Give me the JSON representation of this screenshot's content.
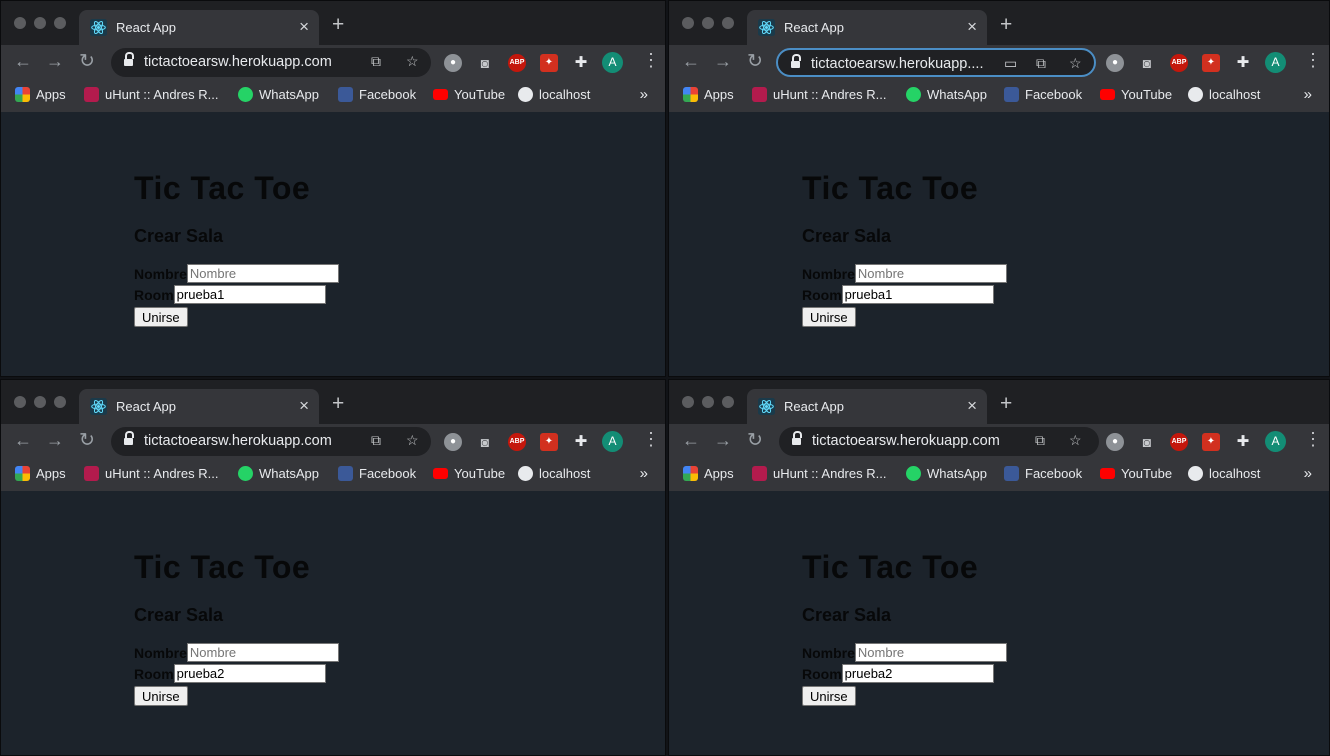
{
  "windows": [
    {
      "tab": {
        "title": "React App"
      },
      "address": {
        "url": "tictactoearsw.herokuapp.com",
        "focused": false
      },
      "bookmarks": [
        "Apps",
        "uHunt :: Andres R...",
        "WhatsApp",
        "Facebook",
        "YouTube",
        "localhost"
      ],
      "avatar": "A",
      "page": {
        "title": "Tic Tac Toe",
        "subtitle": "Crear Sala",
        "name_label": "Nombre",
        "name_placeholder": "Nombre",
        "name_value": "",
        "room_label": "Room",
        "room_value": "prueba1",
        "join_label": "Unirse"
      }
    },
    {
      "tab": {
        "title": "React App"
      },
      "address": {
        "url": "tictactoearsw.herokuapp....",
        "focused": true
      },
      "bookmarks": [
        "Apps",
        "uHunt :: Andres R...",
        "WhatsApp",
        "Facebook",
        "YouTube",
        "localhost"
      ],
      "avatar": "A",
      "page": {
        "title": "Tic Tac Toe",
        "subtitle": "Crear Sala",
        "name_label": "Nombre",
        "name_placeholder": "Nombre",
        "name_value": "",
        "room_label": "Room",
        "room_value": "prueba1",
        "join_label": "Unirse"
      }
    },
    {
      "tab": {
        "title": "React App"
      },
      "address": {
        "url": "tictactoearsw.herokuapp.com",
        "focused": false
      },
      "bookmarks": [
        "Apps",
        "uHunt :: Andres R...",
        "WhatsApp",
        "Facebook",
        "YouTube",
        "localhost"
      ],
      "avatar": "A",
      "page": {
        "title": "Tic Tac Toe",
        "subtitle": "Crear Sala",
        "name_label": "Nombre",
        "name_placeholder": "Nombre",
        "name_value": "",
        "room_label": "Room",
        "room_value": "prueba2",
        "join_label": "Unirse"
      }
    },
    {
      "tab": {
        "title": "React App"
      },
      "address": {
        "url": "tictactoearsw.herokuapp.com",
        "focused": false
      },
      "bookmarks": [
        "Apps",
        "uHunt :: Andres R...",
        "WhatsApp",
        "Facebook",
        "YouTube",
        "localhost"
      ],
      "avatar": "A",
      "page": {
        "title": "Tic Tac Toe",
        "subtitle": "Crear Sala",
        "name_label": "Nombre",
        "name_placeholder": "Nombre",
        "name_value": "",
        "room_label": "Room",
        "room_value": "prueba2",
        "join_label": "Unirse"
      }
    }
  ],
  "colors": {
    "page_background": "#1c232b",
    "chrome_dark": "#1f2023",
    "chrome_toolbar": "#35363a",
    "focus_ring": "#4b8ec5",
    "avatar": "#138d75"
  },
  "icons": {
    "favicon": "react-icon",
    "toolbar": [
      "discord-icon",
      "camera-icon",
      "adblock-icon",
      "extension-icon",
      "puzzle-icon"
    ]
  }
}
